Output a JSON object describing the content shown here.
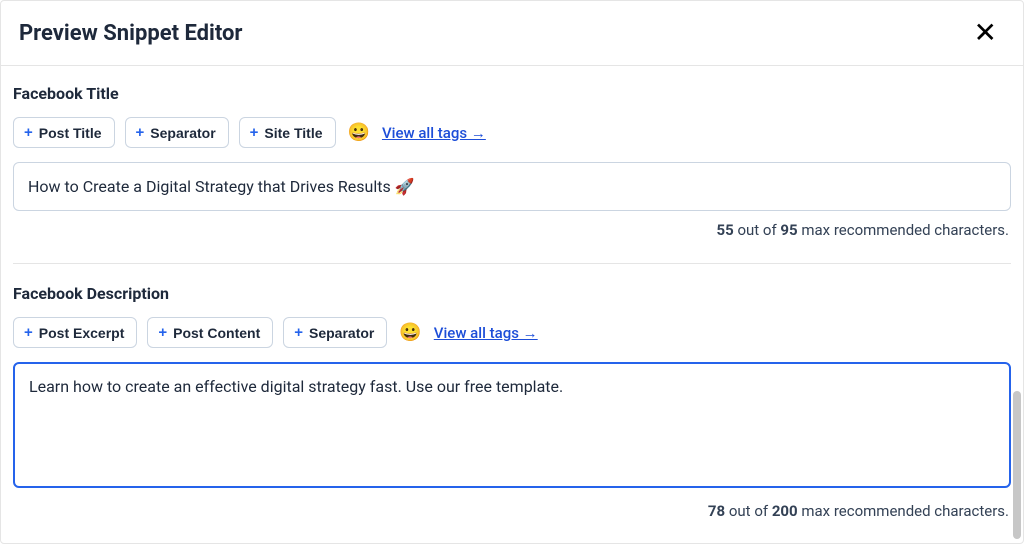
{
  "header": {
    "title": "Preview Snippet Editor"
  },
  "facebookTitle": {
    "label": "Facebook Title",
    "tags": {
      "postTitle": "Post Title",
      "separator": "Separator",
      "siteTitle": "Site Title"
    },
    "emoji": "😀",
    "viewAllTags": "View all tags →",
    "value": "How to Create a Digital Strategy that Drives Results 🚀",
    "counter": {
      "current": "55",
      "text1": " out of ",
      "max": "95",
      "text2": " max recommended characters."
    }
  },
  "facebookDescription": {
    "label": "Facebook Description",
    "tags": {
      "postExcerpt": "Post Excerpt",
      "postContent": "Post Content",
      "separator": "Separator"
    },
    "emoji": "😀",
    "viewAllTags": "View all tags →",
    "value": "Learn how to create an effective digital strategy fast. Use our free template.",
    "counter": {
      "current": "78",
      "text1": " out of ",
      "max": "200",
      "text2": " max recommended characters."
    }
  }
}
